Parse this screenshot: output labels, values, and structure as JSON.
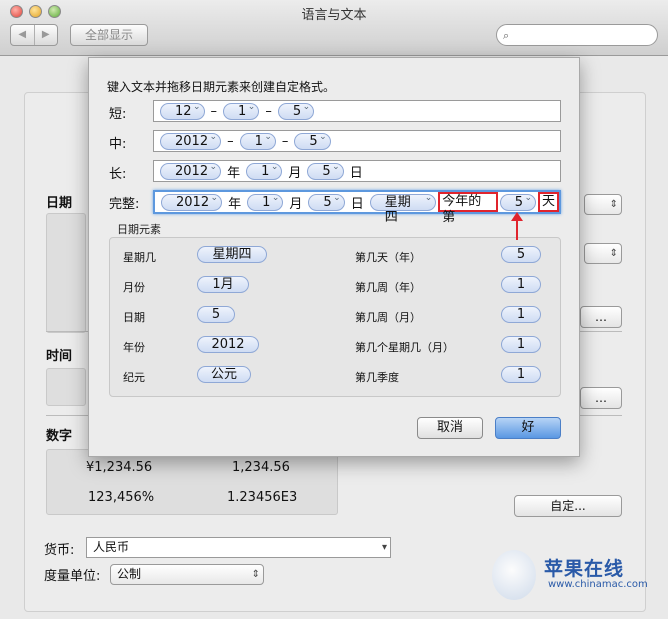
{
  "window": {
    "title": "语言与文本",
    "show_all": "全部显示",
    "nav_back": "◀",
    "nav_fwd": "▶"
  },
  "search": {
    "placeholder": ""
  },
  "background": {
    "section_date": "日期",
    "section_time": "时间",
    "section_number": "数字",
    "customize": "自定...",
    "number_examples": [
      "¥1,234.56",
      "1,234.56",
      "123,456%",
      "1.23456E3"
    ],
    "currency_label": "货币:",
    "currency_value": "人民币",
    "measure_label": "度量单位:",
    "measure_value": "公制"
  },
  "dialog": {
    "instruction": "键入文本并拖移日期元素来创建自定格式。",
    "rows": [
      {
        "label": "短:",
        "tokens": [
          "12",
          "1",
          "5"
        ],
        "separators": [
          "–",
          "–"
        ]
      },
      {
        "label": "中:",
        "tokens": [
          "2012",
          "1",
          "5"
        ],
        "separators": [
          "–",
          "–"
        ]
      },
      {
        "label": "长:",
        "tokens": [
          "2012",
          "1",
          "5"
        ],
        "suffixes": [
          "年",
          "月",
          "日"
        ]
      },
      {
        "label": "完整:",
        "tokens": [
          "2012",
          "1",
          "5",
          "星期四",
          "5"
        ],
        "suffixes": [
          "年",
          "月",
          "日"
        ],
        "highlight_prefix": "今年的第",
        "highlight_suffix": "天"
      }
    ],
    "elements_title": "日期元素",
    "elements_left": [
      {
        "label": "星期几",
        "value": "星期四"
      },
      {
        "label": "月份",
        "value": "1月"
      },
      {
        "label": "日期",
        "value": "5"
      },
      {
        "label": "年份",
        "value": "2012"
      },
      {
        "label": "纪元",
        "value": "公元"
      }
    ],
    "elements_right": [
      {
        "label": "第几天（年）",
        "value": "5"
      },
      {
        "label": "第几周（年）",
        "value": "1"
      },
      {
        "label": "第几周（月）",
        "value": "1"
      },
      {
        "label": "第几个星期几（月）",
        "value": "1"
      },
      {
        "label": "第几季度",
        "value": "1"
      }
    ],
    "cancel": "取消",
    "ok": "好"
  },
  "watermark": {
    "title": "苹果在线",
    "url": "www.chinamac.com"
  },
  "colors": {
    "highlight": "#e0242d",
    "token_border": "#8fa8d6",
    "focus": "#5d98de"
  }
}
